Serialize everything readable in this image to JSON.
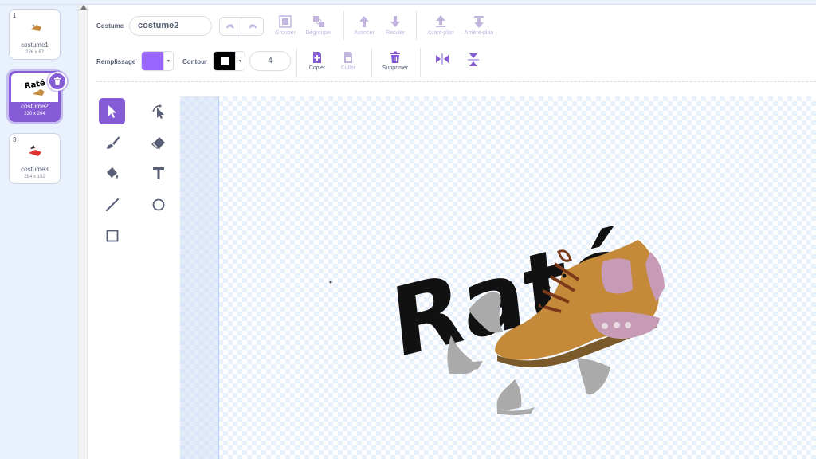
{
  "costumes": [
    {
      "number": "1",
      "name": "costume1",
      "size": "236 x 67"
    },
    {
      "number": "2",
      "name": "costume2",
      "size": "230 x 204"
    },
    {
      "number": "3",
      "name": "costume3",
      "size": "284 x 192"
    }
  ],
  "toolbar": {
    "costume_label": "Costume",
    "costume_name": "costume2",
    "group": "Grouper",
    "ungroup": "Dégrouper",
    "forward": "Avancer",
    "backward": "Reculer",
    "front": "Avant-plan",
    "back": "Arrière-plan",
    "fill_label": "Remplissage",
    "outline_label": "Contour",
    "stroke_width": "4",
    "copy": "Copier",
    "paste": "Coller",
    "delete": "Supprimer"
  },
  "canvas": {
    "art_text": "Raté"
  },
  "colors": {
    "accent": "#855cd6",
    "fill": "#9966ff",
    "outline": "#000000"
  }
}
